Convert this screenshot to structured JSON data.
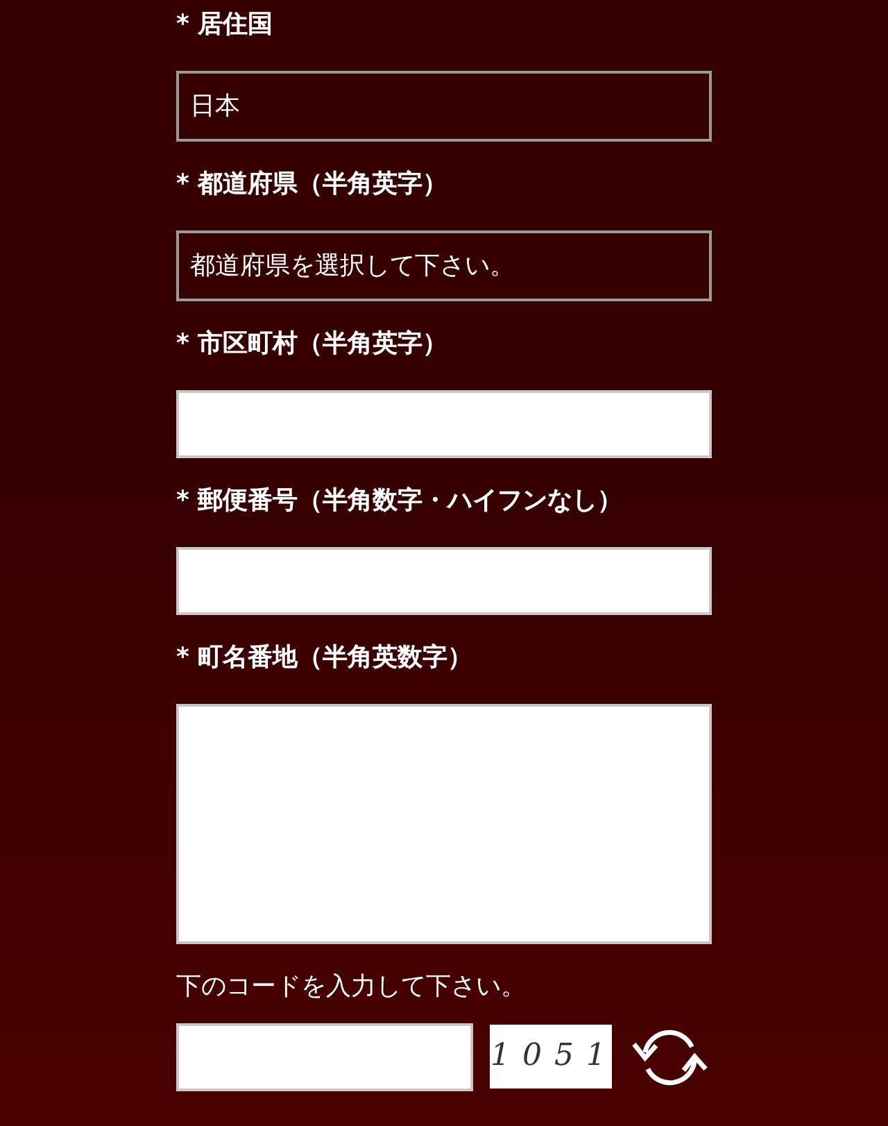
{
  "fields": [
    {
      "kind": "select",
      "label": "* 居住国",
      "value": "日本"
    },
    {
      "kind": "select",
      "label": "* 都道府県（半角英字）",
      "value": "都道府県を選択して下さい。"
    },
    {
      "kind": "text",
      "label": "* 市区町村（半角英字）"
    },
    {
      "kind": "text",
      "label": "* 郵便番号（半角数字・ハイフンなし）"
    },
    {
      "kind": "textarea",
      "label": "* 町名番地（半角英数字）"
    }
  ],
  "captcha": {
    "label": "下のコードを入力して下さい。",
    "code": "1051"
  }
}
